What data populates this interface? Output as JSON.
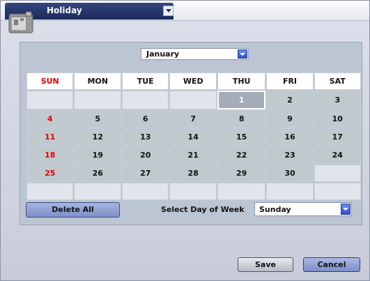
{
  "window": {
    "title": "Holiday"
  },
  "calendar": {
    "month": "January",
    "weekdays": [
      "SUN",
      "MON",
      "TUE",
      "WED",
      "THU",
      "FRI",
      "SAT"
    ],
    "weeks": [
      [
        "",
        "",
        "",
        "",
        "1",
        "2",
        "3"
      ],
      [
        "4",
        "5",
        "6",
        "7",
        "8",
        "9",
        "10"
      ],
      [
        "11",
        "12",
        "13",
        "14",
        "15",
        "16",
        "17"
      ],
      [
        "18",
        "19",
        "20",
        "21",
        "22",
        "23",
        "24"
      ],
      [
        "25",
        "26",
        "27",
        "28",
        "29",
        "30",
        ""
      ],
      [
        "",
        "",
        "",
        "",
        "",
        "",
        ""
      ]
    ],
    "selected_day": "1",
    "sunday_color": "#e60000"
  },
  "controls": {
    "delete_all": "Delete All",
    "select_day_label": "Select Day of Week",
    "select_day_value": "Sunday"
  },
  "footer": {
    "save": "Save",
    "cancel": "Cancel"
  }
}
